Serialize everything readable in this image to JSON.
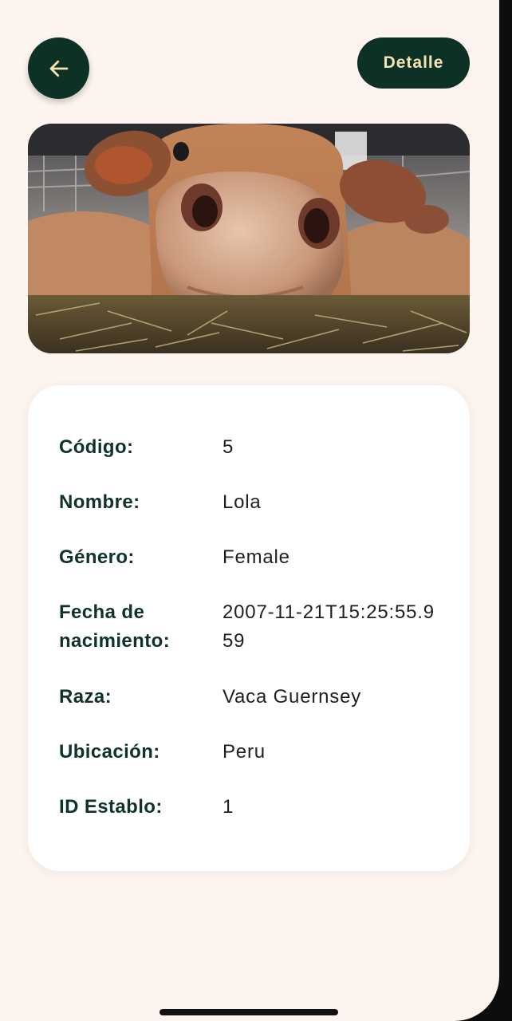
{
  "header": {
    "back_icon": "arrow-left-icon",
    "detail_label": "Detalle"
  },
  "colors": {
    "screen_background": "#fdf4ef",
    "button_background": "#0e3126",
    "button_text": "#f5e4b3",
    "label_text": "#0f3328"
  },
  "details": {
    "codigo": {
      "label": "Código:",
      "value": "5"
    },
    "nombre": {
      "label": "Nombre:",
      "value": "Lola"
    },
    "genero": {
      "label": "Género:",
      "value": "Female"
    },
    "fecha": {
      "label": "Fecha de nacimiento:",
      "value": "2007-11-21T15:25:55.959"
    },
    "raza": {
      "label": "Raza:",
      "value": "Vaca Guernsey"
    },
    "ubicacion": {
      "label": "Ubicación:",
      "value": "Peru"
    },
    "establo": {
      "label": "ID Establo:",
      "value": "1"
    }
  }
}
